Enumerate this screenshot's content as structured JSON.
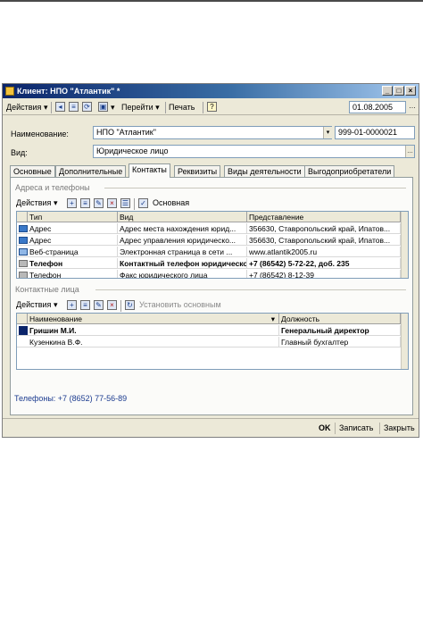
{
  "window": {
    "title": "Клиент: НПО \"Атлантик\" *"
  },
  "toolbar": {
    "actions_label": "Действия",
    "goto_label": "Перейти",
    "print_label": "Печать",
    "help_label": "?",
    "date_value": "01.08.2005"
  },
  "form": {
    "name_label": "Наименование:",
    "name_value": "НПО \"Атлантик\"",
    "code_value": "999-01-0000021",
    "kind_label": "Вид:",
    "kind_value": "Юридическое лицо"
  },
  "tabs": [
    {
      "label": "Основные"
    },
    {
      "label": "Дополнительные"
    },
    {
      "label": "Контакты"
    },
    {
      "label": "Реквизиты"
    },
    {
      "label": "Виды деятельности"
    },
    {
      "label": "Выгодоприобретатели"
    }
  ],
  "contacts": {
    "addresses_title": "Адреса и телефоны",
    "actions_label": "Действия",
    "main_label": "Основная",
    "columns": [
      "Тип",
      "Вид",
      "Представление"
    ],
    "rows": [
      {
        "type": "Адрес",
        "kind": "Адрес места нахождения юрид...",
        "view": "356630, Ставропольский край, Ипатов..."
      },
      {
        "type": "Адрес",
        "kind": "Адрес управления юридическо...",
        "view": "356630, Ставропольский край, Ипатов..."
      },
      {
        "type": "Веб-страница",
        "kind": "Электронная страница в сети ...",
        "view": "www.atlantik2005.ru"
      },
      {
        "type": "Телефон",
        "kind": "Контактный телефон юридическо...",
        "view": "+7 (86542) 5-72-22, доб. 235"
      },
      {
        "type": "Телефон",
        "kind": "Факс юридического лица",
        "view": "+7 (86542) 8-12-39"
      }
    ],
    "persons_title": "Контактные лица",
    "persons_actions_label": "Действия",
    "set_main_label": "Установить основным",
    "persons_columns": [
      "Наименование",
      "Должность"
    ],
    "persons": [
      {
        "name": "Гришин М.И.",
        "position": "Генеральный директор"
      },
      {
        "name": "Кузенкина В.Ф.",
        "position": "Главный бухгалтер"
      }
    ],
    "phones_text": "Телефоны: +7 (8652) 77-56-89"
  },
  "footer": {
    "ok_label": "OK",
    "save_label": "Записать",
    "close_label": "Закрыть"
  }
}
